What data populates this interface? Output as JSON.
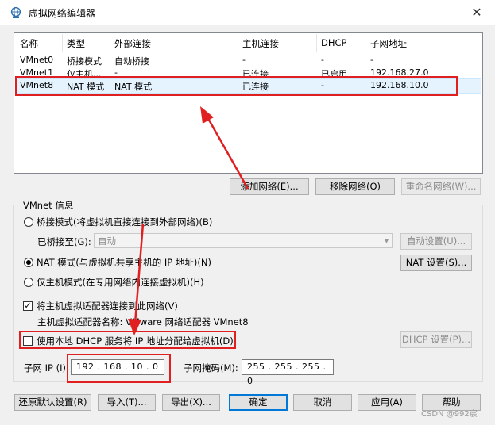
{
  "window": {
    "title": "虚拟网络编辑器",
    "close_glyph": "✕",
    "icon": "globe-network-icon"
  },
  "table": {
    "headers": [
      "名称",
      "类型",
      "外部连接",
      "主机连接",
      "DHCP",
      "子网地址"
    ],
    "rows": [
      [
        "VMnet0",
        "桥接模式",
        "自动桥接",
        "-",
        "-",
        "-"
      ],
      [
        "VMnet1",
        "仅主机...",
        "-",
        "已连接",
        "已启用",
        "192.168.27.0"
      ],
      [
        "VMnet8",
        "NAT 模式",
        "NAT 模式",
        "已连接",
        "-",
        "192.168.10.0"
      ]
    ],
    "selected_row": 2
  },
  "table_buttons": {
    "add": "添加网络(E)...",
    "remove": "移除网络(O)",
    "rename": "重命名网络(W)..."
  },
  "vmnet_info": {
    "title": "VMnet 信息",
    "bridged_label": "桥接模式(将虚拟机直接连接到外部网络)(B)",
    "bridged_to_label": "已桥接至(G):",
    "bridged_to_value": "自动",
    "auto_settings": "自动设置(U)...",
    "nat_label": "NAT 模式(与虚拟机共享主机的 IP 地址)(N)",
    "nat_settings": "NAT 设置(S)...",
    "hostonly_label": "仅主机模式(在专用网络内连接虚拟机)(H)",
    "selected_mode": "nat",
    "connect_adapter_label": "将主机虚拟适配器连接到此网络(V)",
    "connect_adapter_checked": true,
    "adapter_name": "主机虚拟适配器名称: VMware 网络适配器 VMnet8",
    "dhcp_label": "使用本地 DHCP 服务将 IP 地址分配给虚拟机(D)",
    "dhcp_checked": false,
    "dhcp_settings": "DHCP 设置(P)...",
    "subnet_ip_label": "子网 IP (I):",
    "subnet_ip_value": "192 . 168 . 10 . 0",
    "subnet_mask_label": "子网掩码(M):",
    "subnet_mask_value": "255 . 255 . 255 . 0"
  },
  "footer_buttons": {
    "restore": "还原默认设置(R)",
    "import": "导入(T)...",
    "export": "导出(X)...",
    "ok": "确定",
    "cancel": "取消",
    "apply": "应用(A)",
    "help": "帮助"
  },
  "watermark": "CSDN @992宸",
  "annotation_color": "#e02020"
}
